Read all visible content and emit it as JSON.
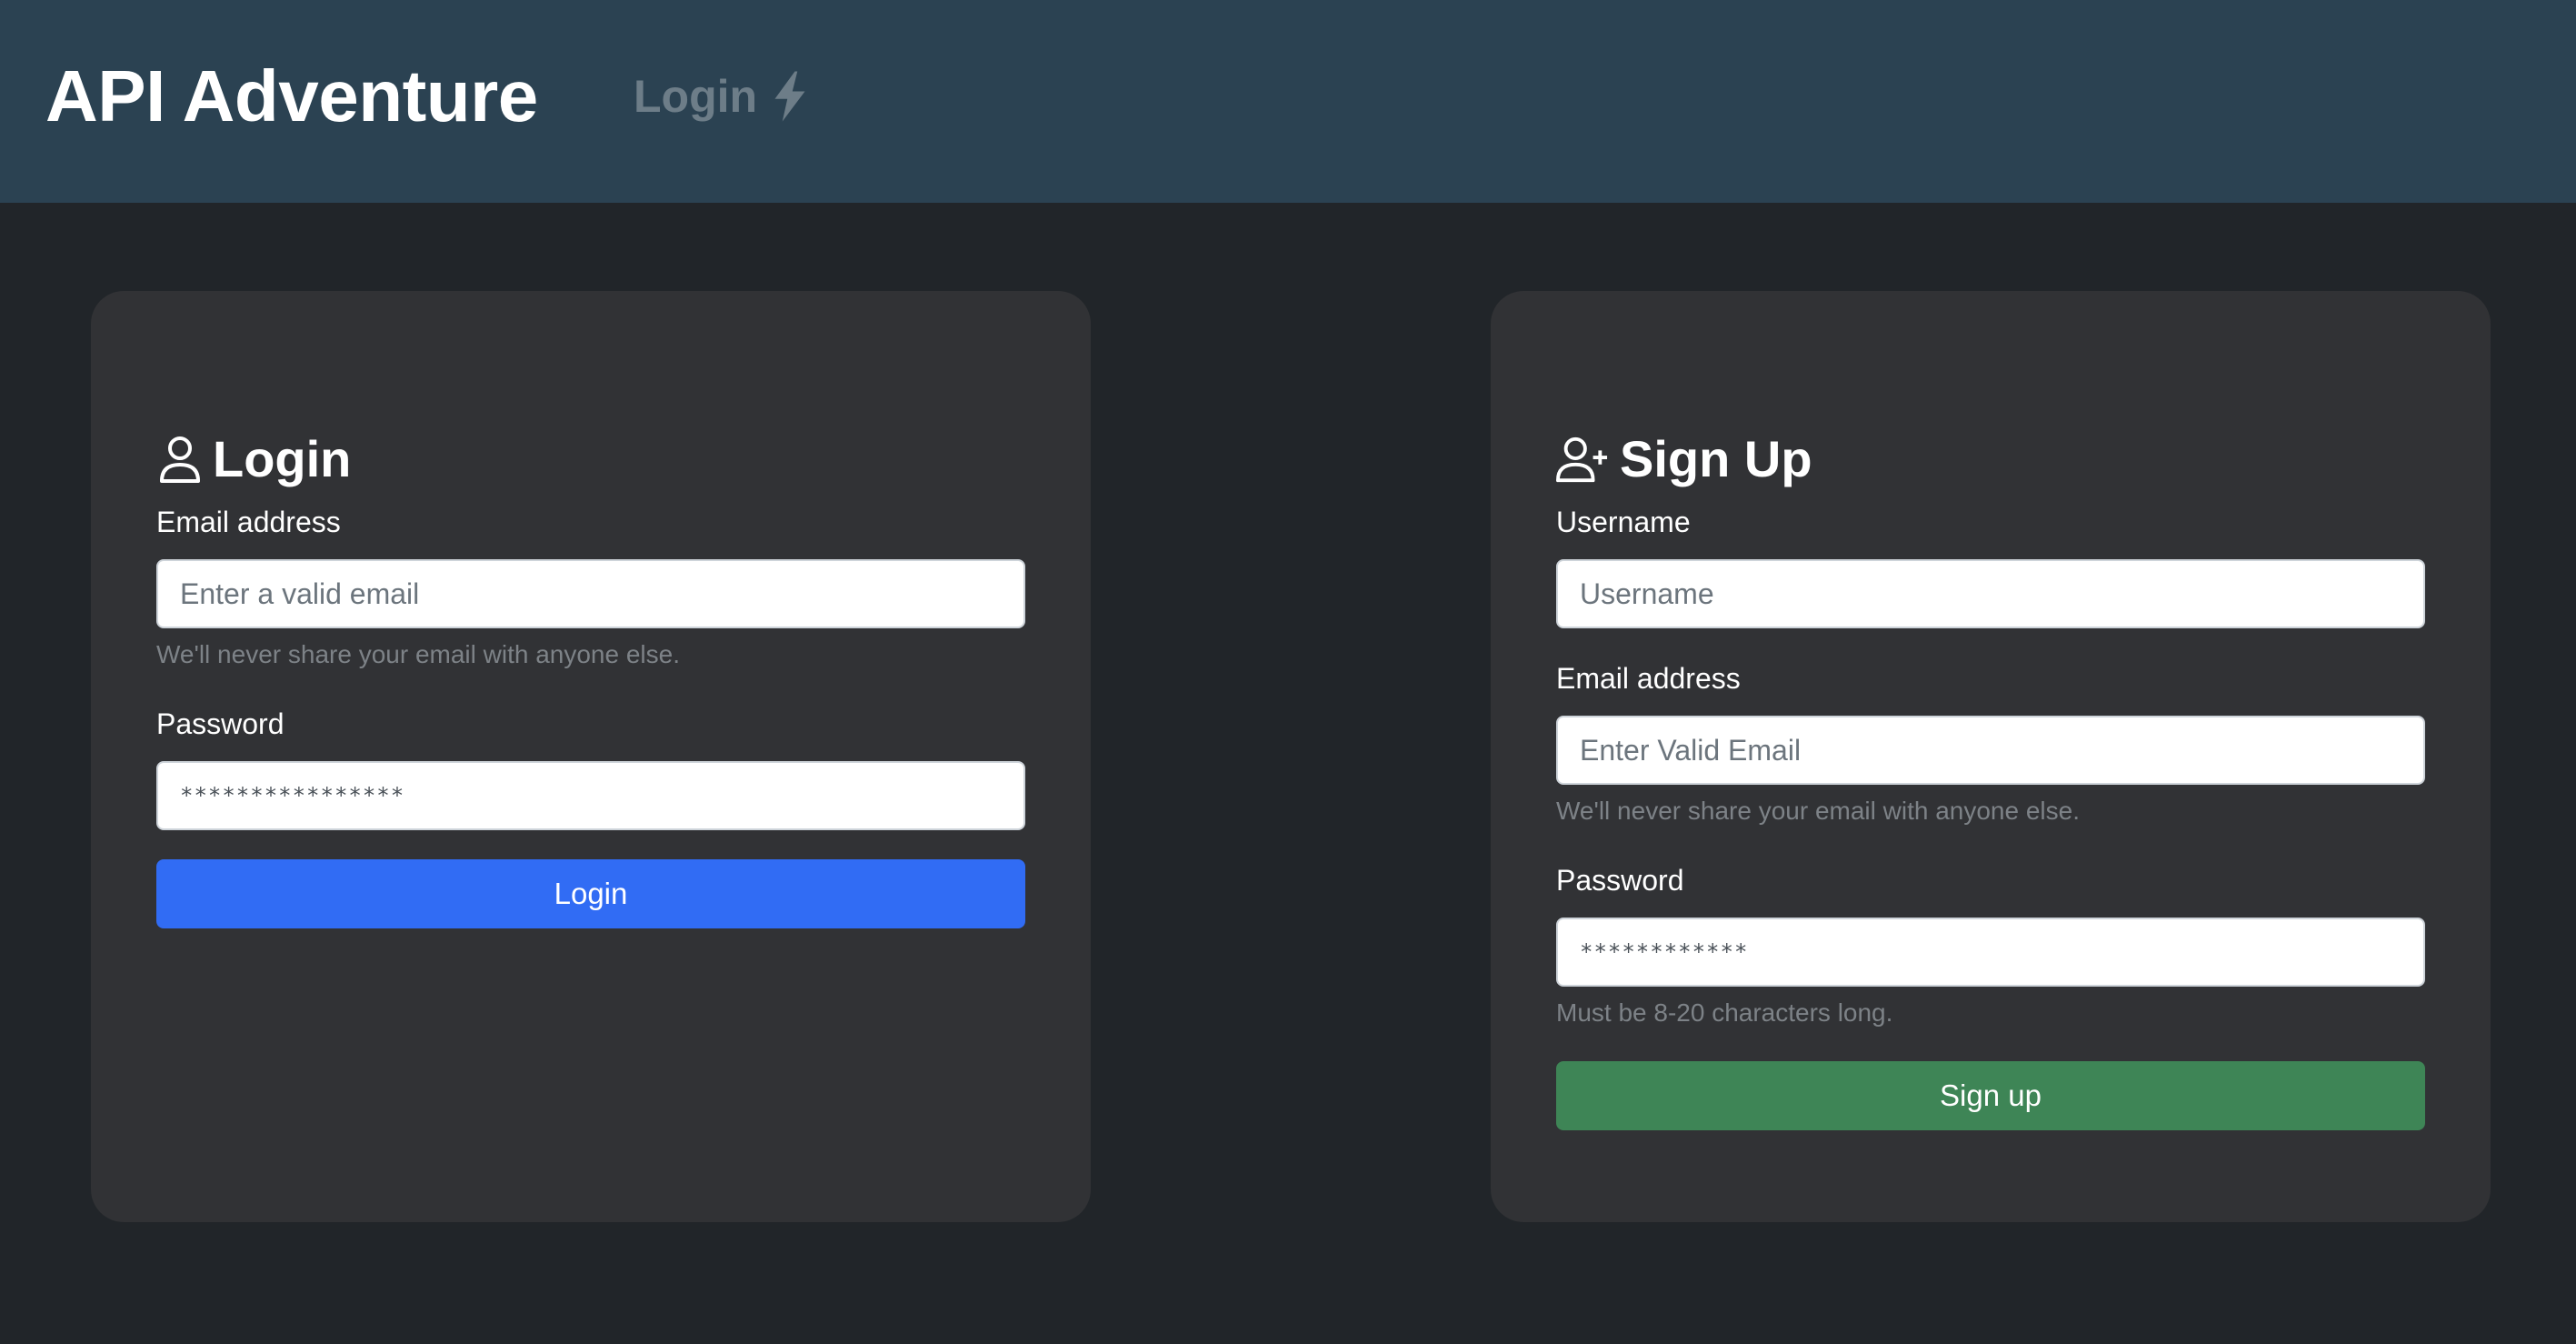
{
  "navbar": {
    "brand": "API Adventure",
    "link_label": "Login"
  },
  "login": {
    "title": "Login",
    "email_label": "Email address",
    "email_placeholder": "Enter a valid email",
    "email_help": "We'll never share your email with anyone else.",
    "password_label": "Password",
    "password_value": "****************",
    "submit_label": "Login"
  },
  "signup": {
    "title": "Sign Up",
    "username_label": "Username",
    "username_placeholder": "Username",
    "email_label": "Email address",
    "email_placeholder": "Enter Valid Email",
    "email_help": "We'll never share your email with anyone else.",
    "password_label": "Password",
    "password_value": "************",
    "password_help": "Must be 8-20 characters long.",
    "submit_label": "Sign up"
  },
  "colors": {
    "navbar_bg": "#2b4252",
    "page_bg": "#212529",
    "card_bg": "#313235",
    "primary": "#316cf4",
    "success": "#3e8556"
  },
  "icons": {
    "nav_link": "lightning-icon",
    "login_heading": "person-icon",
    "signup_heading": "person-plus-icon"
  }
}
